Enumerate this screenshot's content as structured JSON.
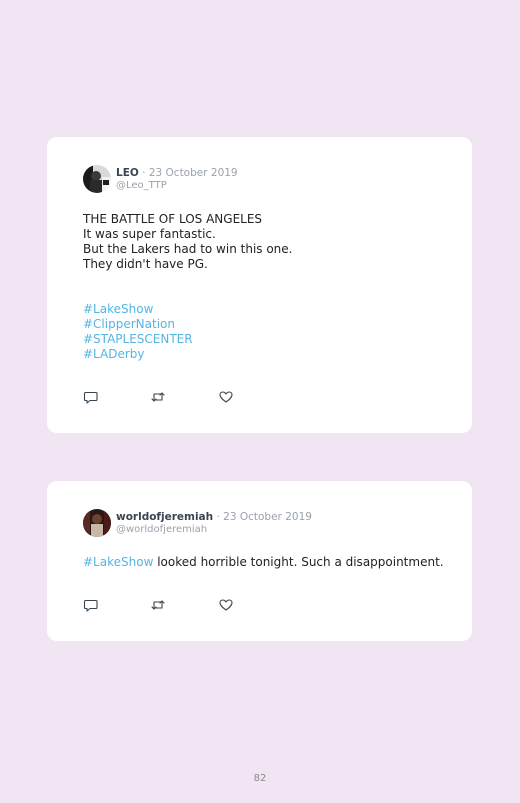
{
  "tweets": [
    {
      "name": "LEO",
      "date": "23 October 2019",
      "handle": "@Leo_TTP",
      "lines": [
        "THE BATTLE OF LOS ANGELES",
        "It was super fantastic.",
        "But the Lakers had to win this one.",
        "They didn't have PG."
      ],
      "hashtags": [
        "#LakeShow",
        "#ClipperNation",
        "#STAPLESCENTER",
        "#LADerby"
      ]
    },
    {
      "name": "worldofjeremiah",
      "date": "23 October 2019",
      "handle": "@worldofjeremiah",
      "hashtag": "#LakeShow",
      "text": "looked horrible tonight. Such a disappointment."
    }
  ],
  "separator": "·",
  "page_number": "82",
  "icons": [
    "reply-icon",
    "retweet-icon",
    "like-icon"
  ],
  "colors": {
    "background": "#f1e4f3",
    "card": "#ffffff",
    "hashtag": "#55b5e3",
    "muted": "#9aa2ad"
  }
}
